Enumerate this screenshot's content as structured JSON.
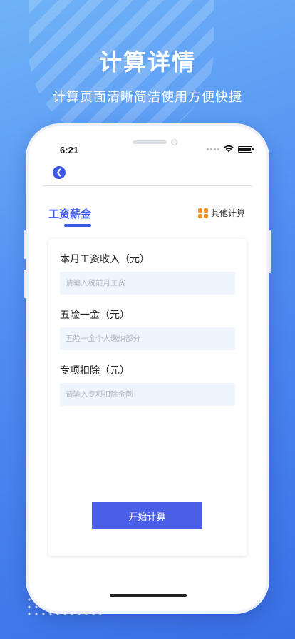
{
  "hero": {
    "title": "计算详情",
    "subtitle": "计算页面清晰简洁使用方便快捷"
  },
  "status_bar": {
    "time": "6:21"
  },
  "nav": {
    "back_icon": "chevron-left-icon"
  },
  "tabs": {
    "active_label": "工资薪金",
    "other_label": "其他计算",
    "other_icon": "four-squares-icon"
  },
  "form": {
    "fields": [
      {
        "label": "本月工资收入（元）",
        "placeholder": "请输入税前月工资",
        "value": ""
      },
      {
        "label": "五险一金（元）",
        "placeholder": "五险一金个人缴纳部分",
        "value": ""
      },
      {
        "label": "专项扣除（元）",
        "placeholder": "请输入专项扣除金额",
        "value": ""
      }
    ],
    "submit_label": "开始计算"
  },
  "colors": {
    "accent": "#3d57e6",
    "button": "#4a5ee8",
    "icon_orange": "#f0922c",
    "input_bg": "#eef5fd"
  }
}
